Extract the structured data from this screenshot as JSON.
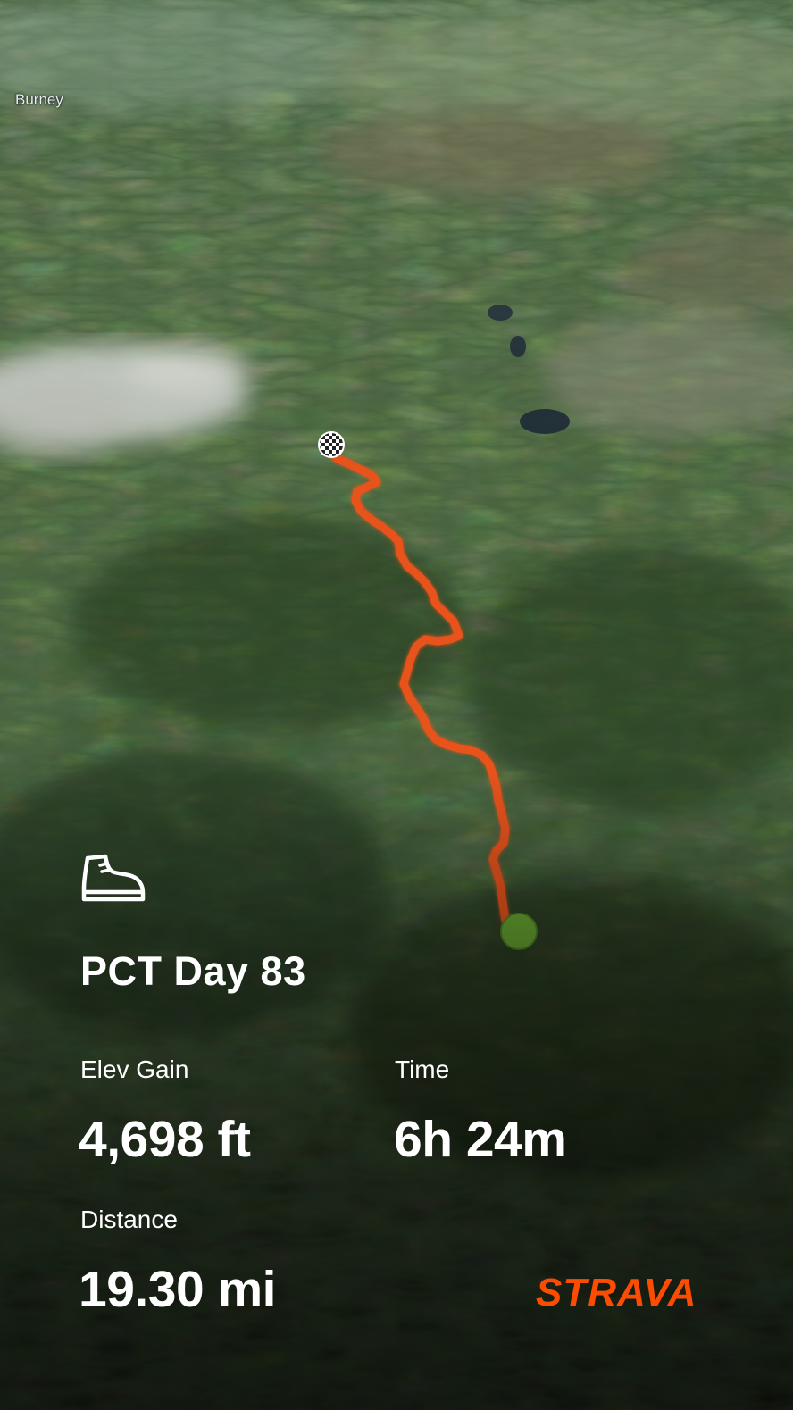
{
  "map": {
    "place_label": "Burney",
    "route_color": "#e8531b",
    "start_marker_color": "#6aa832",
    "finish_marker": "checkered-flag"
  },
  "activity": {
    "icon": "hiking-boot-icon",
    "title": "PCT Day 83"
  },
  "stats": {
    "elev_gain": {
      "label": "Elev Gain",
      "value": "4,698 ft"
    },
    "time": {
      "label": "Time",
      "value": "6h 24m"
    },
    "distance": {
      "label": "Distance",
      "value": "19.30 mi"
    }
  },
  "brand": {
    "name": "STRAVA",
    "color": "#fc4c02"
  }
}
